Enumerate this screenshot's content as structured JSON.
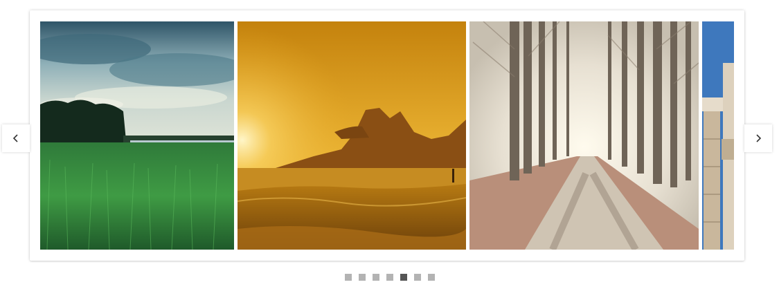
{
  "carousel": {
    "slides": [
      {
        "subject": "green-field-under-cloudy-sky"
      },
      {
        "subject": "sunset-beach-with-mountain"
      },
      {
        "subject": "tree-lined-road-in-fog"
      },
      {
        "subject": "stone-ruins-column-blue-sky"
      }
    ],
    "prev_icon": "chevron-left-icon",
    "next_icon": "chevron-right-icon",
    "dots_count": 7,
    "active_dot": 4
  },
  "colors": {
    "dot_inactive": "#b3b3b3",
    "dot_active": "#555555",
    "card_bg": "#ffffff"
  }
}
